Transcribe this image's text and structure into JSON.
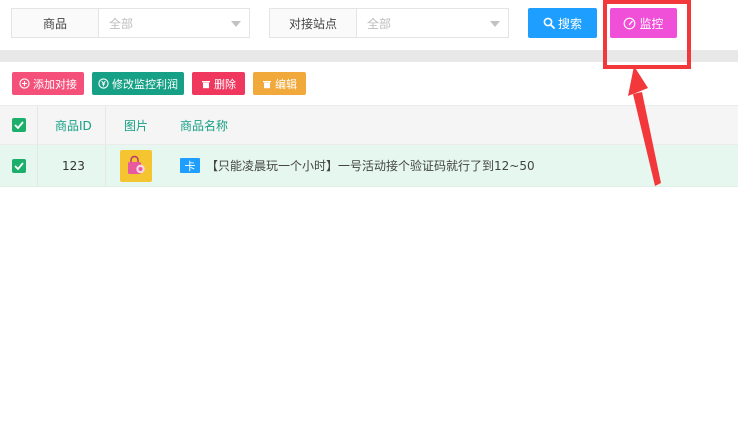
{
  "filters": {
    "product": {
      "label": "商品",
      "placeholder": "全部"
    },
    "site": {
      "label": "对接站点",
      "placeholder": "全部"
    }
  },
  "buttons": {
    "search": "搜索",
    "monitor": "监控"
  },
  "toolbar": {
    "add": "添加对接",
    "profit": "修改监控利润",
    "delete": "删除",
    "edit": "编辑"
  },
  "table": {
    "headers": {
      "id": "商品ID",
      "image": "图片",
      "name": "商品名称"
    },
    "rows": [
      {
        "id": "123",
        "tag": "卡",
        "name": "【只能凌晨玩一个小时】一号活动接个验证码就行了到12~50"
      }
    ]
  },
  "colors": {
    "search": "#1e9fff",
    "monitor": "#f04fd8",
    "highlight": "#f2383b",
    "selected_row": "#e5f7ef",
    "accent_green": "#16a085"
  }
}
